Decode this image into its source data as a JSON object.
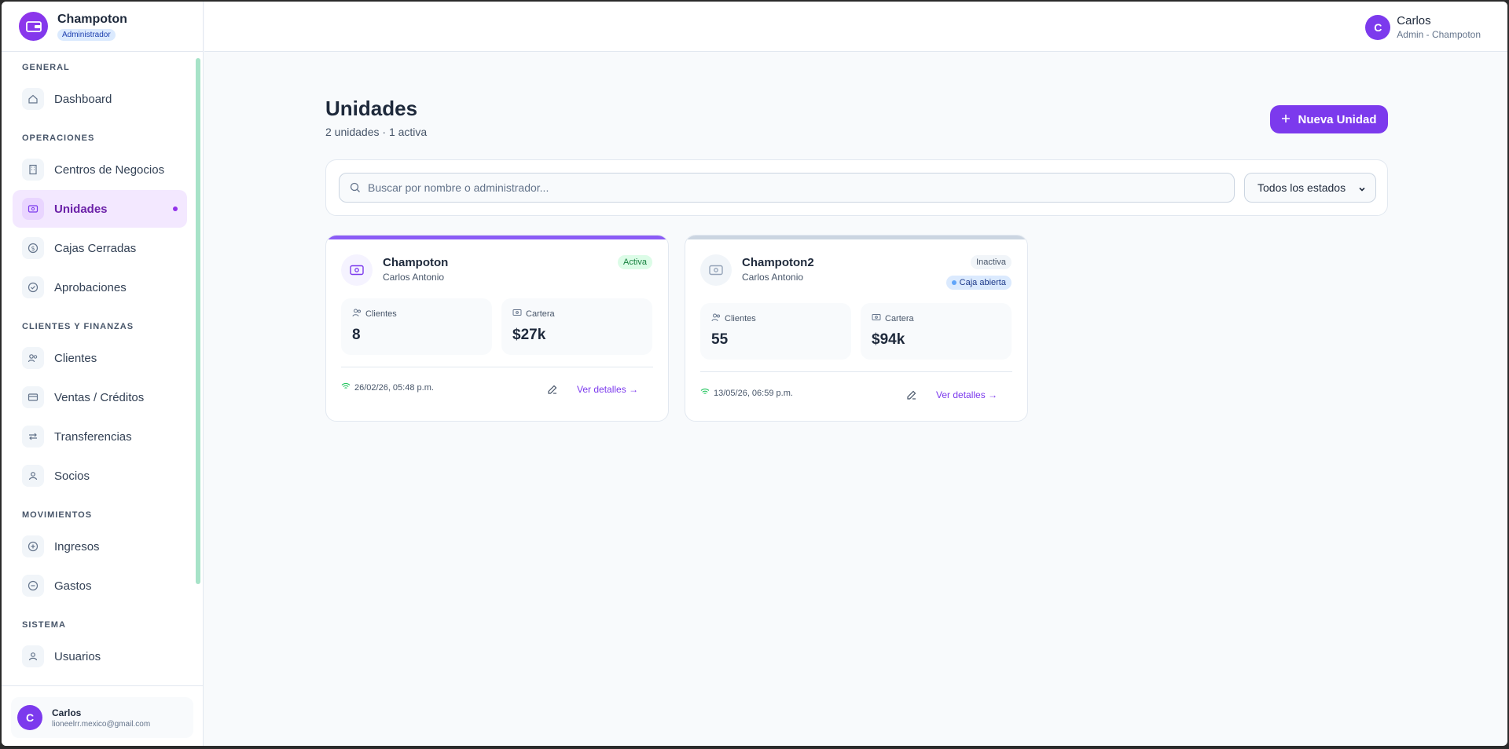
{
  "brand": {
    "name": "Champoton",
    "role_badge": "Administrador"
  },
  "sidebar": {
    "sections": [
      {
        "title": "GENERAL",
        "items": [
          {
            "label": "Dashboard",
            "icon": "home-icon"
          }
        ]
      },
      {
        "title": "OPERACIONES",
        "items": [
          {
            "label": "Centros de Negocios",
            "icon": "building-icon"
          },
          {
            "label": "Unidades",
            "icon": "wallet-icon",
            "active": true
          },
          {
            "label": "Cajas Cerradas",
            "icon": "dollar-circle-icon"
          },
          {
            "label": "Aprobaciones",
            "icon": "check-circle-icon"
          }
        ]
      },
      {
        "title": "CLIENTES Y FINANZAS",
        "items": [
          {
            "label": "Clientes",
            "icon": "users-icon"
          },
          {
            "label": "Ventas / Créditos",
            "icon": "credit-card-icon"
          },
          {
            "label": "Transferencias",
            "icon": "arrows-icon"
          },
          {
            "label": "Socios",
            "icon": "partners-icon"
          }
        ]
      },
      {
        "title": "MOVIMIENTOS",
        "items": [
          {
            "label": "Ingresos",
            "icon": "plus-circle-icon"
          },
          {
            "label": "Gastos",
            "icon": "minus-circle-icon"
          }
        ]
      },
      {
        "title": "SISTEMA",
        "items": [
          {
            "label": "Usuarios",
            "icon": "user-group-icon"
          }
        ]
      }
    ],
    "user": {
      "initial": "C",
      "name": "Carlos",
      "email": "lioneelrr.mexico@gmail.com"
    }
  },
  "header": {
    "user": {
      "initial": "C",
      "name": "Carlos",
      "role": "Admin - Champoton"
    }
  },
  "main": {
    "title": "Unidades",
    "subtitle": "2 unidades · 1 activa",
    "new_button": "Nueva Unidad",
    "search": {
      "placeholder": "Buscar por nombre o administrador..."
    },
    "status_filter": {
      "selected": "Todos los estados"
    },
    "cards": [
      {
        "name": "Champoton",
        "admin": "Carlos Antonio",
        "status": "Activa",
        "clients_label": "Clientes",
        "clients": "8",
        "portfolio_label": "Cartera",
        "portfolio": "$27k",
        "timestamp": "26/02/26, 05:48 p.m.",
        "details": "Ver detalles",
        "accent": "#8b5cf6"
      },
      {
        "name": "Champoton2",
        "admin": "Carlos Antonio",
        "status": "Inactiva",
        "extra_badge": "Caja abierta",
        "clients_label": "Clientes",
        "clients": "55",
        "portfolio_label": "Cartera",
        "portfolio": "$94k",
        "timestamp": "13/05/26, 06:59 p.m.",
        "details": "Ver detalles",
        "accent": "#cbd5e1"
      }
    ]
  }
}
